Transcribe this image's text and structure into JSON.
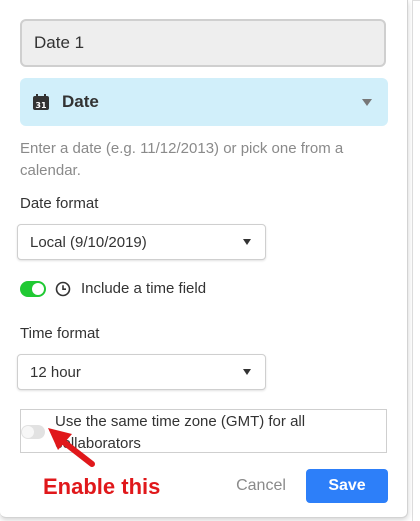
{
  "field": {
    "name_value": "Date 1",
    "type_label": "Date",
    "type_icon": "calendar-icon",
    "help_text": "Enter a date (e.g. 11/12/2013) or pick one from a calendar."
  },
  "date_format": {
    "label": "Date format",
    "selected": "Local (9/10/2019)"
  },
  "time_field": {
    "enabled": true,
    "label": "Include a time field",
    "icon": "clock-icon"
  },
  "time_format": {
    "label": "Time format",
    "selected": "12 hour"
  },
  "timezone": {
    "enabled": false,
    "label": "Use the same time zone (GMT) for all collaborators"
  },
  "annotation": {
    "text": "Enable this",
    "color": "#e0181b"
  },
  "actions": {
    "cancel_label": "Cancel",
    "save_label": "Save"
  },
  "colors": {
    "accent": "#2d7ff9",
    "type_bg": "#d1effa",
    "toggle_on": "#20c933"
  }
}
